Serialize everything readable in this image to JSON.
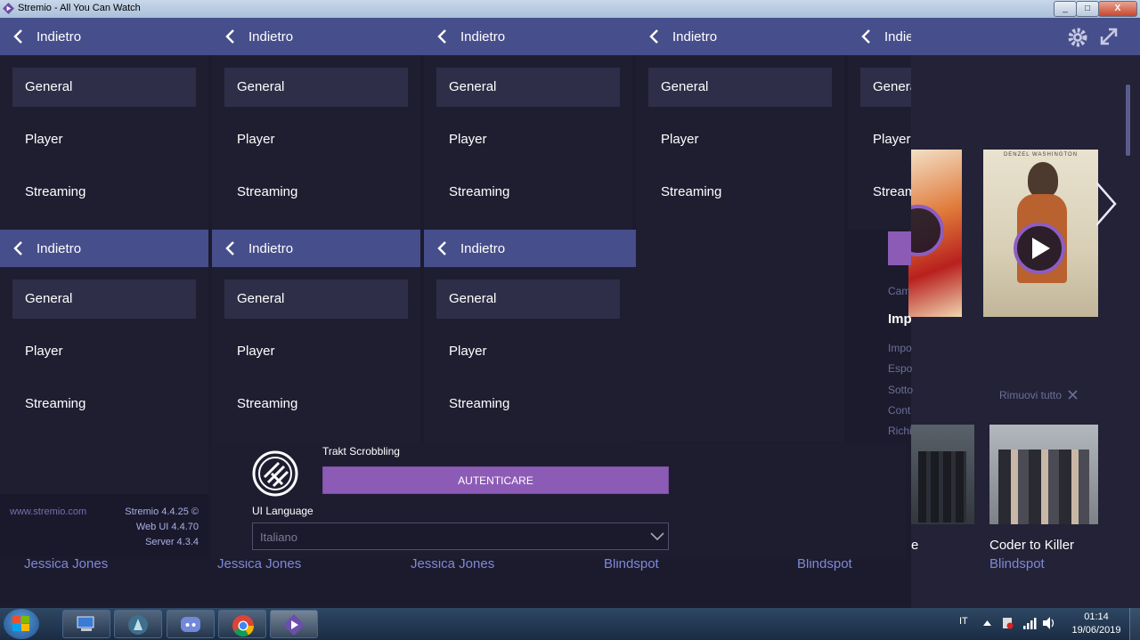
{
  "window": {
    "title": "Stremio - All You Can Watch",
    "minimize": "_",
    "maximize": "□",
    "close": "X"
  },
  "nav": {
    "back_label": "Indietro",
    "items": [
      "General",
      "Player",
      "Streaming"
    ]
  },
  "footer": {
    "site": "www.stremio.com",
    "version_app": "Stremio 4.4.25 ©",
    "version_webui": "Web UI 4.4.70",
    "version_server": "Server 4.3.4"
  },
  "trakt": {
    "label": "Trakt Scrobbling",
    "button": "AUTENTICARE"
  },
  "language": {
    "label": "UI Language",
    "value": "Italiano"
  },
  "row_titles": [
    "Jessica Jones",
    "Jessica Jones",
    "Jessica Jones",
    "Blindspot",
    "Blindspot"
  ],
  "right": {
    "poster2_header": "DENZEL WASHINGTON",
    "side_links": [
      "Cam",
      "Imp",
      "Impo",
      "Espo",
      "Sotto",
      "Cont",
      "Richi"
    ],
    "remove_all": "Rimuovi tutto",
    "card2_title": "Coder to Killer",
    "card2_subtitle": "Blindspot",
    "card1_title_fragment": "e"
  },
  "taskbar": {
    "lang": "IT",
    "time": "01:14",
    "date": "19/06/2019"
  },
  "colors": {
    "accent_header": "#474e8c",
    "accent_button": "#8c5bb6",
    "panel_bg": "#1f1e31",
    "selected_bg": "#2f2e48"
  }
}
